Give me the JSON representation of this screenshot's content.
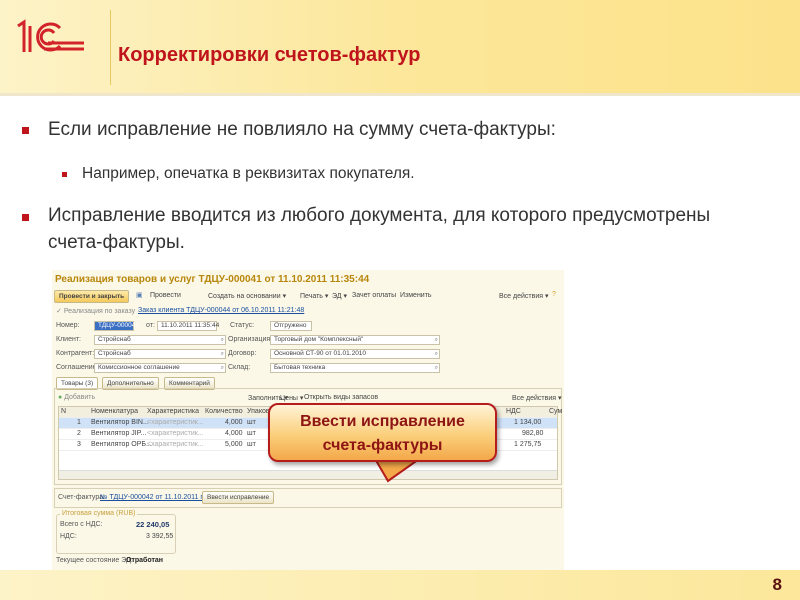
{
  "slide": {
    "title": "Корректировки счетов-фактур",
    "page_number": "8",
    "logo_text": "1С",
    "bullets": [
      {
        "text": "Если исправление не повлияло на сумму счета-фактуры:",
        "sub": [
          "Например, опечатка в реквизитах покупателя."
        ]
      },
      {
        "text": "Исправление вводится из любого документа, для которого предусмотрены счета-фактуры."
      }
    ],
    "callout": {
      "line1": "Ввести исправление",
      "line2": "счета-фактуры"
    },
    "colors": {
      "accent": "#c0141c",
      "header": "#fce79a"
    }
  },
  "doc": {
    "title": "Реализация товаров и услуг ТДЦУ-000041 от 11.10.2011 11:35:44",
    "toolbar": {
      "post_close": "Провести и закрыть",
      "post": "Провести",
      "create_based": "Создать на основании ▾",
      "print": "Печать ▾",
      "ed": "ЭД ▾",
      "offset": "Зачет оплаты",
      "edit": "Изменить",
      "all_actions": "Все действия ▾"
    },
    "order": {
      "label": "Реализация по заказу",
      "link": "Заказ клиента ТДЦУ-000044 от 06.10.2011 11:21:48"
    },
    "fields": {
      "number_label": "Номер:",
      "number": "ТДЦУ-000041",
      "date_label": "от:",
      "date": "11.10.2011 11:35:44",
      "status_label": "Статус:",
      "status": "Отгружено",
      "client_label": "Клиент:",
      "client": "Стройснаб",
      "org_label": "Организация:",
      "org": "Торговый дом \"Комплексный\"",
      "contractor_label": "Контрагент:",
      "contractor": "Стройснаб",
      "contract_label": "Договор:",
      "contract": "Основной СТ-90 от 01.01.2010",
      "agreement_label": "Соглашение:",
      "agreement": "Комиссионное соглашение",
      "warehouse_label": "Склад:",
      "warehouse": "Бытовая техника"
    },
    "tabs": [
      "Товары (3)",
      "Дополнительно",
      "Комментарий"
    ],
    "table_toolbar": {
      "add": "Добавить",
      "fill": "Заполнить ▾",
      "prices": "Цены ▾",
      "open_kinds": "Открыть виды запасов",
      "all_actions": "Все действия ▾"
    },
    "columns": [
      "N",
      "Номенклатура",
      "Характеристика",
      "Количество",
      "Упаков",
      "НДС",
      "Сум"
    ],
    "rows": [
      {
        "n": "1",
        "item": "Вентилятор BIN...",
        "char": "<характеристик...",
        "qty": "4,000",
        "unit": "шт",
        "vat": "1 134,00"
      },
      {
        "n": "2",
        "item": "Вентилятор JIP...",
        "char": "<характеристик...",
        "qty": "4,000",
        "unit": "шт",
        "vat": "982,80"
      },
      {
        "n": "3",
        "item": "Вентилятор ОРБ...",
        "char": "<характеристик...",
        "qty": "5,000",
        "unit": "шт",
        "vat": "1 275,75"
      }
    ],
    "invoice": {
      "label": "Счет-фактура:",
      "link": "№ ТДЦУ-000042 от 11.10.2011 г.",
      "button": "Ввести исправление"
    },
    "totals": {
      "legend": "Итоговая сумма (RUB)",
      "total_label": "Всего с НДС:",
      "total": "22 240,05",
      "vat_label": "НДС:",
      "vat": "3 392,55"
    },
    "state": {
      "label": "Текущее состояние ЭД:",
      "value": "Отработан"
    }
  }
}
